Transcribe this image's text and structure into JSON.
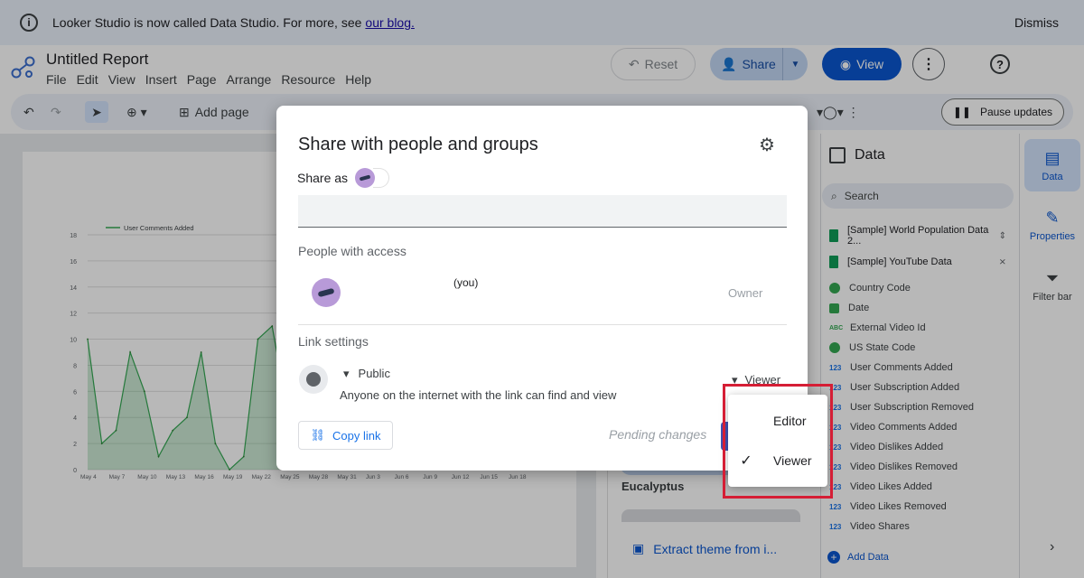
{
  "banner": {
    "text": "Looker Studio is now called Data Studio. For more, see",
    "link": "our blog.",
    "dismiss": "Dismiss"
  },
  "header": {
    "title": "Untitled Report",
    "menus": [
      "File",
      "Edit",
      "View",
      "Insert",
      "Page",
      "Arrange",
      "Resource",
      "Help"
    ],
    "reset": "Reset",
    "share": "Share",
    "view": "View"
  },
  "toolbar": {
    "add_page": "Add page",
    "pause_updates": "Pause updates"
  },
  "chart_data": {
    "type": "line",
    "legend": "User Comments Added",
    "y_ticks": [
      0,
      2,
      4,
      6,
      8,
      10,
      12,
      14,
      16,
      18
    ],
    "ylim": [
      0,
      18
    ],
    "x_ticks": [
      "May 4",
      "May 7",
      "May 10",
      "May 13",
      "May 16",
      "May 19",
      "May 22",
      "May 25",
      "May 28",
      "May 31",
      "Jun 3",
      "Jun 6",
      "Jun 9",
      "Jun 12",
      "Jun 15",
      "Jun 18"
    ],
    "values": [
      10,
      2,
      3,
      9,
      6,
      1,
      3,
      4,
      9,
      2,
      0,
      1,
      10,
      11,
      5,
      0,
      0,
      0,
      2,
      3,
      0,
      1,
      0
    ]
  },
  "theme": {
    "name": "Eucalyptus",
    "extract": "Extract theme from i..."
  },
  "data_panel": {
    "title": "Data",
    "search_placeholder": "Search",
    "sources": [
      "[Sample] World Population Data 2...",
      "[Sample] YouTube Data"
    ],
    "fields": [
      {
        "name": "Country Code",
        "icon": "geo"
      },
      {
        "name": "Date",
        "icon": "date"
      },
      {
        "name": "External Video Id",
        "icon": "text"
      },
      {
        "name": "US State Code",
        "icon": "geo"
      },
      {
        "name": "User Comments Added",
        "icon": "number"
      },
      {
        "name": "User Subscription Added",
        "icon": "number"
      },
      {
        "name": "User Subscription Removed",
        "icon": "number"
      },
      {
        "name": "Video Comments Added",
        "icon": "number"
      },
      {
        "name": "Video Dislikes Added",
        "icon": "number"
      },
      {
        "name": "Video Dislikes Removed",
        "icon": "number"
      },
      {
        "name": "Video Likes Added",
        "icon": "number"
      },
      {
        "name": "Video Likes Removed",
        "icon": "number"
      },
      {
        "name": "Video Shares",
        "icon": "number"
      }
    ],
    "add_data": "Add Data"
  },
  "rail": {
    "data": "Data",
    "properties": "Properties",
    "filter_bar": "Filter bar"
  },
  "dialog": {
    "title": "Share with people and groups",
    "share_as": "Share as",
    "people_label": "People with access",
    "you": "(you)",
    "owner": "Owner",
    "link_settings": "Link settings",
    "public": "Public",
    "public_desc": "Anyone on the internet with the link can find and view",
    "role": "Viewer",
    "copy_link": "Copy link",
    "pending": "Pending changes"
  },
  "role_menu": {
    "editor": "Editor",
    "viewer": "Viewer",
    "selected": "Viewer"
  },
  "colors": {
    "accent": "#0b57d0",
    "highlight": "#d51e35",
    "series": "#34a853"
  }
}
